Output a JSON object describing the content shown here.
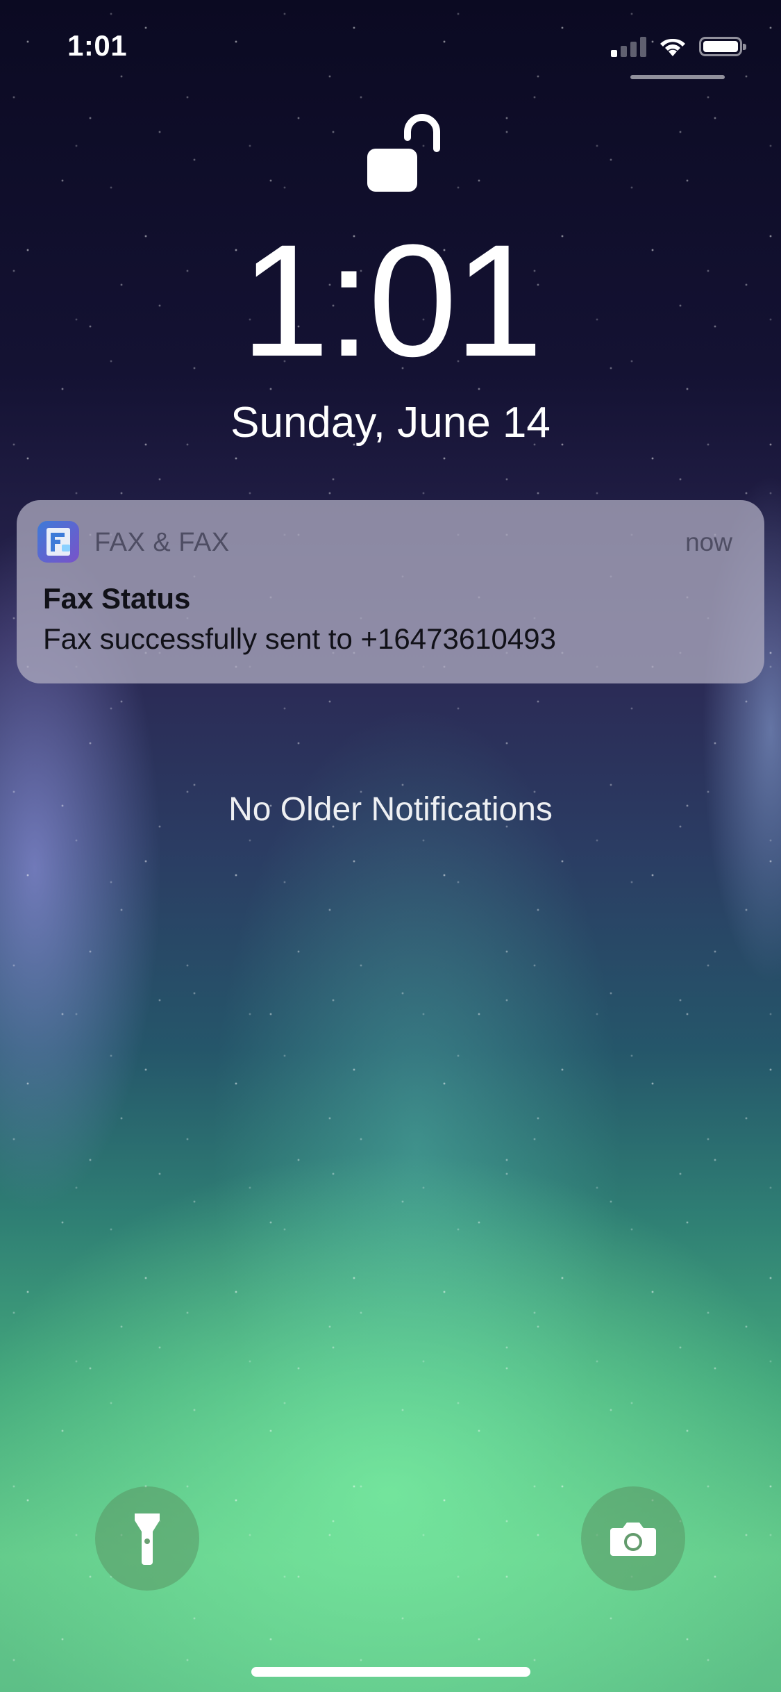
{
  "status_bar": {
    "time": "1:01",
    "signal_bars_on": 1,
    "signal_bars_total": 4,
    "battery_level": 1.0
  },
  "lock_screen": {
    "time": "1:01",
    "date": "Sunday, June 14",
    "lock_icon": "unlocked-padlock-icon"
  },
  "notification": {
    "app_icon": "fax-app-icon",
    "app_name": "FAX & FAX",
    "time": "now",
    "title": "Fax Status",
    "body": "Fax successfully sent to +16473610493"
  },
  "no_older_text": "No Older Notifications",
  "quick_actions": {
    "left_icon": "flashlight-icon",
    "right_icon": "camera-icon"
  },
  "colors": {
    "notification_bg": "#AAA8BE",
    "text_primary": "#FFFFFF",
    "wallpaper_top": "#0B0A22",
    "wallpaper_bottom": "#63C98A"
  }
}
